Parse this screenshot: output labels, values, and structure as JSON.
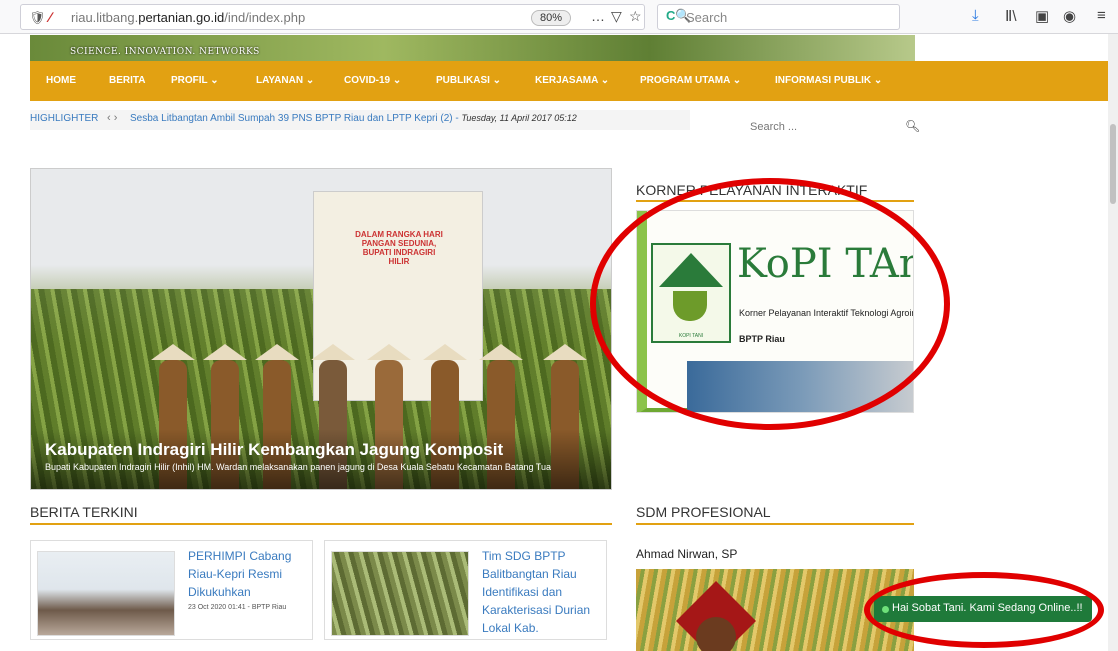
{
  "browser": {
    "url_prefix": "riau.litbang.",
    "url_domain": "pertanian.go.id",
    "url_suffix": "/ind/index.php",
    "zoom": "80%",
    "more_label": "…",
    "search_placeholder": "Search"
  },
  "header": {
    "tagline": "SCIENCE. INNOVATION. NETWORKS"
  },
  "nav": {
    "items": [
      {
        "label": "HOME"
      },
      {
        "label": "BERITA"
      },
      {
        "label": "PROFIL ⌄"
      },
      {
        "label": "LAYANAN ⌄"
      },
      {
        "label": "COVID-19 ⌄"
      },
      {
        "label": "PUBLIKASI ⌄"
      },
      {
        "label": "KERJASAMA ⌄"
      },
      {
        "label": "PROGRAM UTAMA ⌄"
      },
      {
        "label": "INFORMASI PUBLIK ⌄"
      }
    ]
  },
  "highlighter": {
    "label": "HIGHLIGHTER",
    "arrows": "‹ ›",
    "headline": "Sesba Litbangtan Ambil Sumpah 39 PNS BPTP Riau dan LPTP Kepri (2) - ",
    "date": "Tuesday, 11 April 2017 05:12"
  },
  "site_search": {
    "placeholder": "Search ..."
  },
  "hero": {
    "poster_text": "DALAM RANGKA HARI PANGAN SEDUNIA, BUPATI INDRAGIRI HILIR",
    "title": "Kabupaten Indragiri Hilir Kembangkan Jagung Komposit",
    "subtitle": "Bupati Kabupaten Indragiri Hilir (Inhil) HM. Wardan melaksanakan panen jagung di Desa Kuala Sebatu Kecamatan Batang Tua"
  },
  "sidebar": {
    "korner_title": "KORNER PELAYANAN INTERAKTIF",
    "kopi_big": "KoPI TAni",
    "kopi_sub": "Korner Pelayanan Interaktif Teknologi Agroinovasi",
    "kopi_sub2": "BPTP Riau",
    "kopi_logo_text": "KOPI TANI",
    "sdm_title": "SDM PROFESIONAL",
    "sdm_name": "Ahmad Nirwan, SP"
  },
  "berita": {
    "title": "BERITA TERKINI",
    "cards": [
      {
        "title": "PERHIMPI Cabang Riau-Kepri Resmi Dikukuhkan",
        "meta": "23 Oct 2020 01:41 - BPTP Riau"
      },
      {
        "title": "Tim SDG BPTP Balitbangtan Riau Identifikasi dan Karakterisasi Durian Lokal Kab.",
        "meta": ""
      }
    ]
  },
  "chat": {
    "label": "Hai Sobat Tani. Kami Sedang Online..!!"
  },
  "colors": {
    "accent": "#e2a112",
    "link": "#3a7bbf",
    "annotation": "#e00000",
    "chat": "#1f7a3a"
  }
}
